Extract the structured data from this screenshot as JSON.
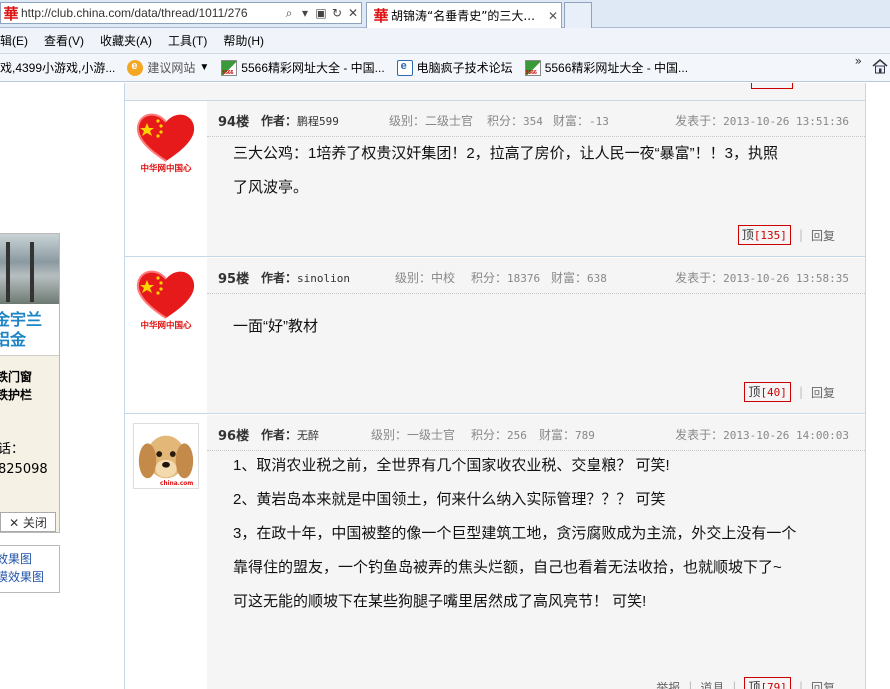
{
  "browser": {
    "url": "http://club.china.com/data/thread/1011/276",
    "tab_title": "胡锦涛“名垂青史”的三大...",
    "tab_close": "✕",
    "menu": [
      "辑(E)",
      "查看(V)",
      "收藏夹(A)",
      "工具(T)",
      "帮助(H)"
    ],
    "favorites": [
      {
        "label": "戏,4399小游戏,小游...",
        "icon": "none"
      },
      {
        "label": "建议网站",
        "icon": "suggest-icon"
      },
      {
        "label": "5566精彩网址大全 - 中国...",
        "icon": "5566-icon"
      },
      {
        "label": "电脑疯子技术论坛",
        "icon": "ie-page-icon"
      },
      {
        "label": "5566精彩网址大全 - 中国...",
        "icon": "5566-icon"
      }
    ],
    "fav_overflow": "»"
  },
  "ad": {
    "blue_lines": [
      "金宇兰",
      "铝金"
    ],
    "mid_lines": [
      "铁门窗",
      "铁护栏"
    ],
    "phone_label": "话：",
    "phone": "825098",
    "close_label": "✕ 关闭",
    "links": [
      "效果图",
      "模效果图"
    ]
  },
  "posts": [
    {
      "floor": "94楼",
      "author_label": "作者：",
      "author": "鹏程599",
      "level_label": "级别：",
      "level": "二级士官",
      "points_label": "积分：",
      "points": "354",
      "wealth_label": "财富：",
      "wealth": "-13",
      "time_label": "发表于：",
      "time": "2013-10-26 13:51:36",
      "avatar": "china-heart",
      "body": [
        "三大公鸡：1培养了权贵汉奸集团！2，拉高了房价，让人民一夜“暴富”！！3，执照",
        "了风波亭。"
      ],
      "ding_label": "顶",
      "ding_count": "[135]",
      "reply_label": "回复"
    },
    {
      "floor": "95楼",
      "author_label": "作者：",
      "author": "sinolion",
      "level_label": "级别：",
      "level": "中校",
      "points_label": "积分：",
      "points": "18376",
      "wealth_label": "财富：",
      "wealth": "638",
      "time_label": "发表于：",
      "time": "2013-10-26 13:58:35",
      "avatar": "china-heart",
      "body": [
        "一面“好”教材"
      ],
      "ding_label": "顶",
      "ding_count": "[40]",
      "reply_label": "回复"
    },
    {
      "floor": "96楼",
      "author_label": "作者：",
      "author": "无醉",
      "level_label": "级别：",
      "level": "一级士官",
      "points_label": "积分：",
      "points": "256",
      "wealth_label": "财富：",
      "wealth": "789",
      "time_label": "发表于：",
      "time": "2013-10-26 14:00:03",
      "avatar": "dog",
      "body": [
        "1、取消农业税之前，全世界有几个国家收农业税、交皇粮？     可笑!",
        "2、黄岩岛本来就是中国领土，何来什么纳入实际管理？？？     可笑",
        "3，在政十年，中国被整的像一个巨型建筑工地，贪污腐败成为主流，外交上没有一个",
        "靠得住的盟友，一个钓鱼岛被弄的焦头烂额，自己也看着无法收拾，也就顺坡下了~",
        "  可这无能的顺坡下在某些狗腿子嘴里居然成了高风亮节！     可笑!"
      ],
      "report_label": "举报",
      "tool_label": "道具",
      "ding_label": "顶",
      "ding_count": "[79]",
      "reply_label": "回复"
    }
  ],
  "avatar_caption_heart": "中华网中国心",
  "avatar_caption_dog": "china.com",
  "colors": {
    "thread_border": "#c5d8e8",
    "post_bg": "#f5f5f5",
    "ding_border": "#cc0000",
    "link_blue": "#2255aa"
  }
}
